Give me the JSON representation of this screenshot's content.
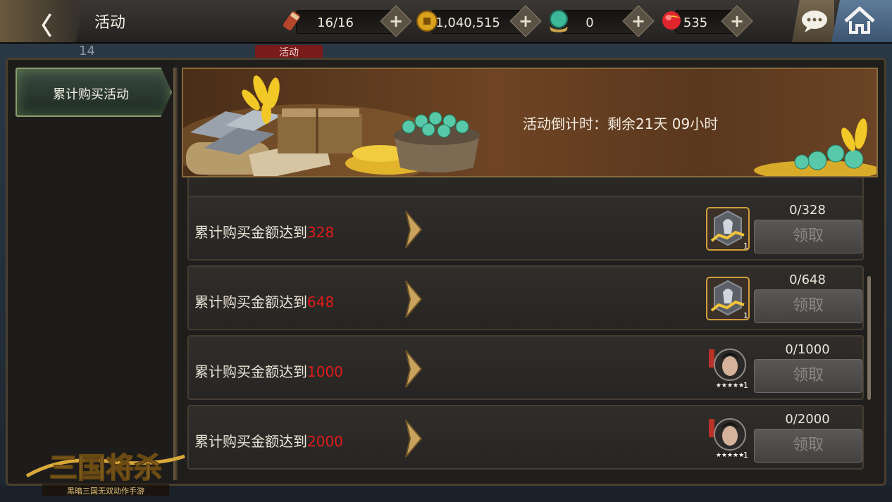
{
  "header": {
    "title": "活动",
    "resources": [
      {
        "name": "scroll-icon",
        "value": "16/16"
      },
      {
        "name": "coin-icon",
        "value": "1,040,515"
      },
      {
        "name": "jade-icon",
        "value": "0"
      },
      {
        "name": "gem-icon",
        "value": "535"
      }
    ]
  },
  "background": {
    "level": "14",
    "tab": "活动"
  },
  "sidebar": {
    "items": [
      {
        "label": "累计购买活动"
      }
    ]
  },
  "banner": {
    "countdown": "活动倒计时：剩余21天 09小时"
  },
  "rows": [
    {
      "prefix": "累计购买金额达到",
      "amount": "328",
      "progress": "0/328",
      "reward_count": "1",
      "reward_type": "gem-reward-icon",
      "claim": "领取"
    },
    {
      "prefix": "累计购买金额达到",
      "amount": "648",
      "progress": "0/648",
      "reward_count": "1",
      "reward_type": "gem-reward-icon",
      "claim": "领取"
    },
    {
      "prefix": "累计购买金额达到",
      "amount": "1000",
      "progress": "0/1000",
      "reward_count": "1",
      "reward_type": "hero-portrait-icon",
      "claim": "领取"
    },
    {
      "prefix": "累计购买金额达到",
      "amount": "2000",
      "progress": "0/2000",
      "reward_count": "1",
      "reward_type": "hero-portrait-icon",
      "claim": "领取"
    }
  ],
  "logo": {
    "title": "三国将杀",
    "subtitle": "黑暗三国无双动作手游"
  },
  "colors": {
    "amount_red": "#e01a1a",
    "frame_gold": "#8a6a3c",
    "home_blue": "#4a6684"
  }
}
